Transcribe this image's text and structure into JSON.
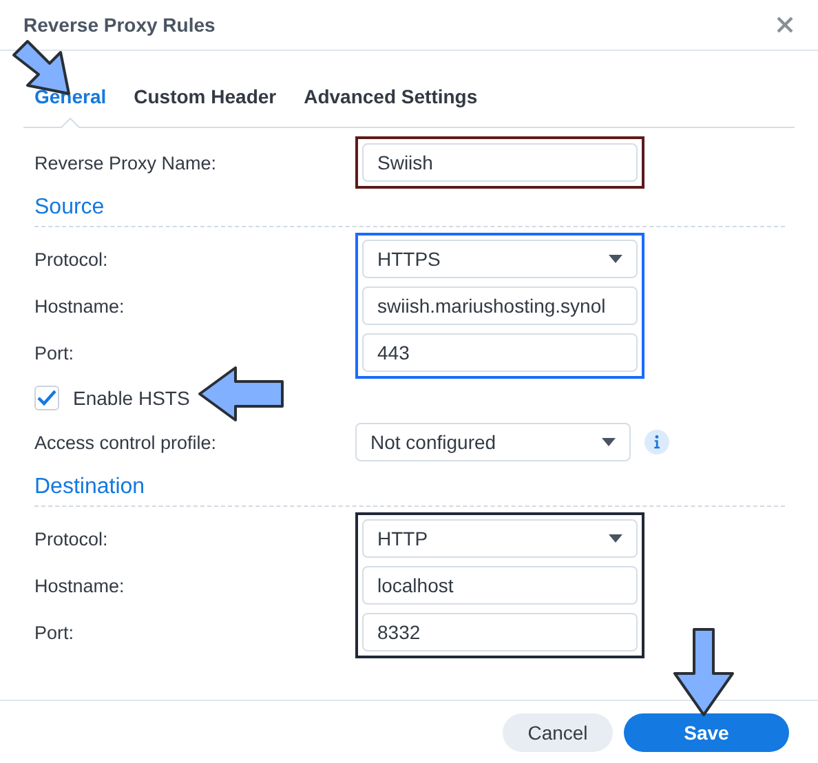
{
  "window": {
    "title": "Reverse Proxy Rules"
  },
  "tabs": [
    {
      "label": "General",
      "selected": true
    },
    {
      "label": "Custom Header",
      "selected": false
    },
    {
      "label": "Advanced Settings",
      "selected": false
    }
  ],
  "name_row": {
    "label": "Reverse Proxy Name:",
    "value": "Swiish",
    "color": "#5c1b1b"
  },
  "sections": [
    {
      "title": "Source",
      "color": "#1a6bff",
      "framed_rows": [
        {
          "kind": "select",
          "label": "Protocol:",
          "value": "HTTPS"
        },
        {
          "kind": "input",
          "label": "Hostname:",
          "value": "swiish.mariushosting.synol"
        },
        {
          "kind": "input",
          "label": "Port:",
          "value": "443"
        }
      ],
      "checkbox": {
        "label": "Enable HSTS",
        "checked": true
      },
      "rows": [
        {
          "kind": "select",
          "label": "Access control profile:",
          "value": "Not configured",
          "info": true
        }
      ]
    },
    {
      "title": "Destination",
      "color": "#1f2937",
      "framed_rows": [
        {
          "kind": "select",
          "label": "Protocol:",
          "value": "HTTP"
        },
        {
          "kind": "input",
          "label": "Hostname:",
          "value": "localhost"
        },
        {
          "kind": "input",
          "label": "Port:",
          "value": "8332"
        }
      ]
    }
  ],
  "buttons": [
    {
      "label": "Cancel",
      "kind": "secondary"
    },
    {
      "label": "Save",
      "kind": "primary"
    }
  ],
  "annotations": [
    {
      "kind": "down-right"
    },
    {
      "kind": "left"
    },
    {
      "kind": "down"
    }
  ]
}
